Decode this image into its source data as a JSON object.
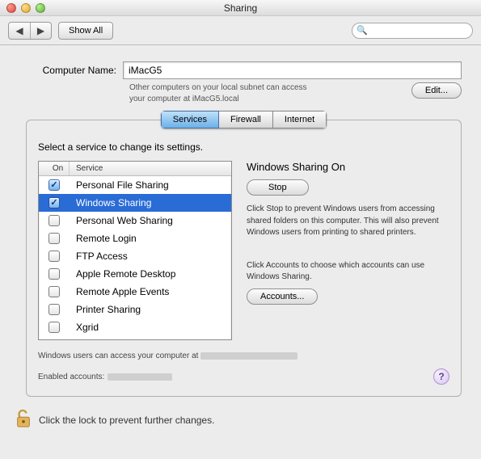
{
  "window": {
    "title": "Sharing"
  },
  "toolbar": {
    "show_all_label": "Show All",
    "search_placeholder": ""
  },
  "computer_name": {
    "label": "Computer Name:",
    "value": "iMacG5",
    "subtext_line1": "Other computers on your local subnet can access",
    "subtext_line2": "your computer at iMacG5.local",
    "edit_label": "Edit..."
  },
  "tabs": {
    "services": "Services",
    "firewall": "Firewall",
    "internet": "Internet",
    "active": "services"
  },
  "services_panel": {
    "prompt": "Select a service to change its settings.",
    "columns": {
      "on": "On",
      "service": "Service"
    },
    "items": [
      {
        "label": "Personal File Sharing",
        "checked": true,
        "selected": false
      },
      {
        "label": "Windows Sharing",
        "checked": true,
        "selected": true
      },
      {
        "label": "Personal Web Sharing",
        "checked": false,
        "selected": false
      },
      {
        "label": "Remote Login",
        "checked": false,
        "selected": false
      },
      {
        "label": "FTP Access",
        "checked": false,
        "selected": false
      },
      {
        "label": "Apple Remote Desktop",
        "checked": false,
        "selected": false
      },
      {
        "label": "Remote Apple Events",
        "checked": false,
        "selected": false
      },
      {
        "label": "Printer Sharing",
        "checked": false,
        "selected": false
      },
      {
        "label": "Xgrid",
        "checked": false,
        "selected": false
      }
    ],
    "detail": {
      "title": "Windows Sharing On",
      "stop_label": "Stop",
      "stop_desc": "Click Stop to prevent Windows users from accessing shared folders on this computer. This will also prevent Windows users from printing to shared printers.",
      "accounts_desc": "Click Accounts to choose which accounts can use Windows Sharing.",
      "accounts_label": "Accounts..."
    },
    "footer": {
      "access_line": "Windows users can access your computer at ",
      "enabled_accounts": "Enabled accounts:"
    }
  },
  "lock": {
    "text": "Click the lock to prevent further changes."
  }
}
